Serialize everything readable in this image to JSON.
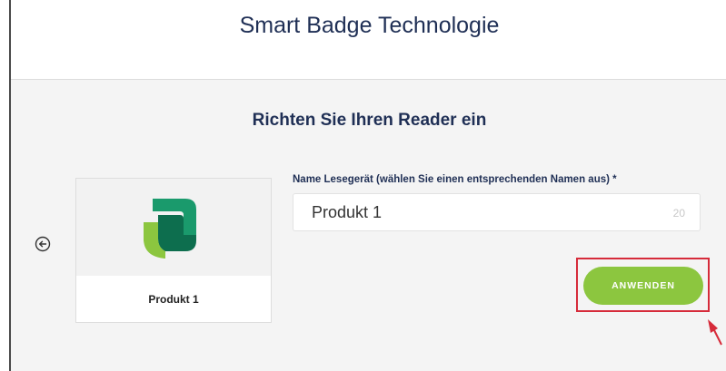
{
  "header": {
    "title": "Smart Badge Technologie"
  },
  "main": {
    "heading": "Richten Sie Ihren Reader ein",
    "back_icon": "circle-arrow-left-icon",
    "product_card": {
      "logo_icon": "green-logo-icon",
      "label": "Produkt 1"
    },
    "name_field": {
      "label": "Name Lesegerät (wählen Sie einen entsprechenden Namen aus) *",
      "value": "Produkt 1",
      "remaining_chars": "20"
    },
    "apply_button": {
      "label": "ANWENDEN"
    },
    "annotation": {
      "highlight_color": "#d62b3a",
      "pointer_icon": "red-arrow-icon"
    }
  },
  "colors": {
    "primary_text": "#1f2f55",
    "accent_green": "#8cc63f",
    "content_bg": "#f4f4f4"
  }
}
